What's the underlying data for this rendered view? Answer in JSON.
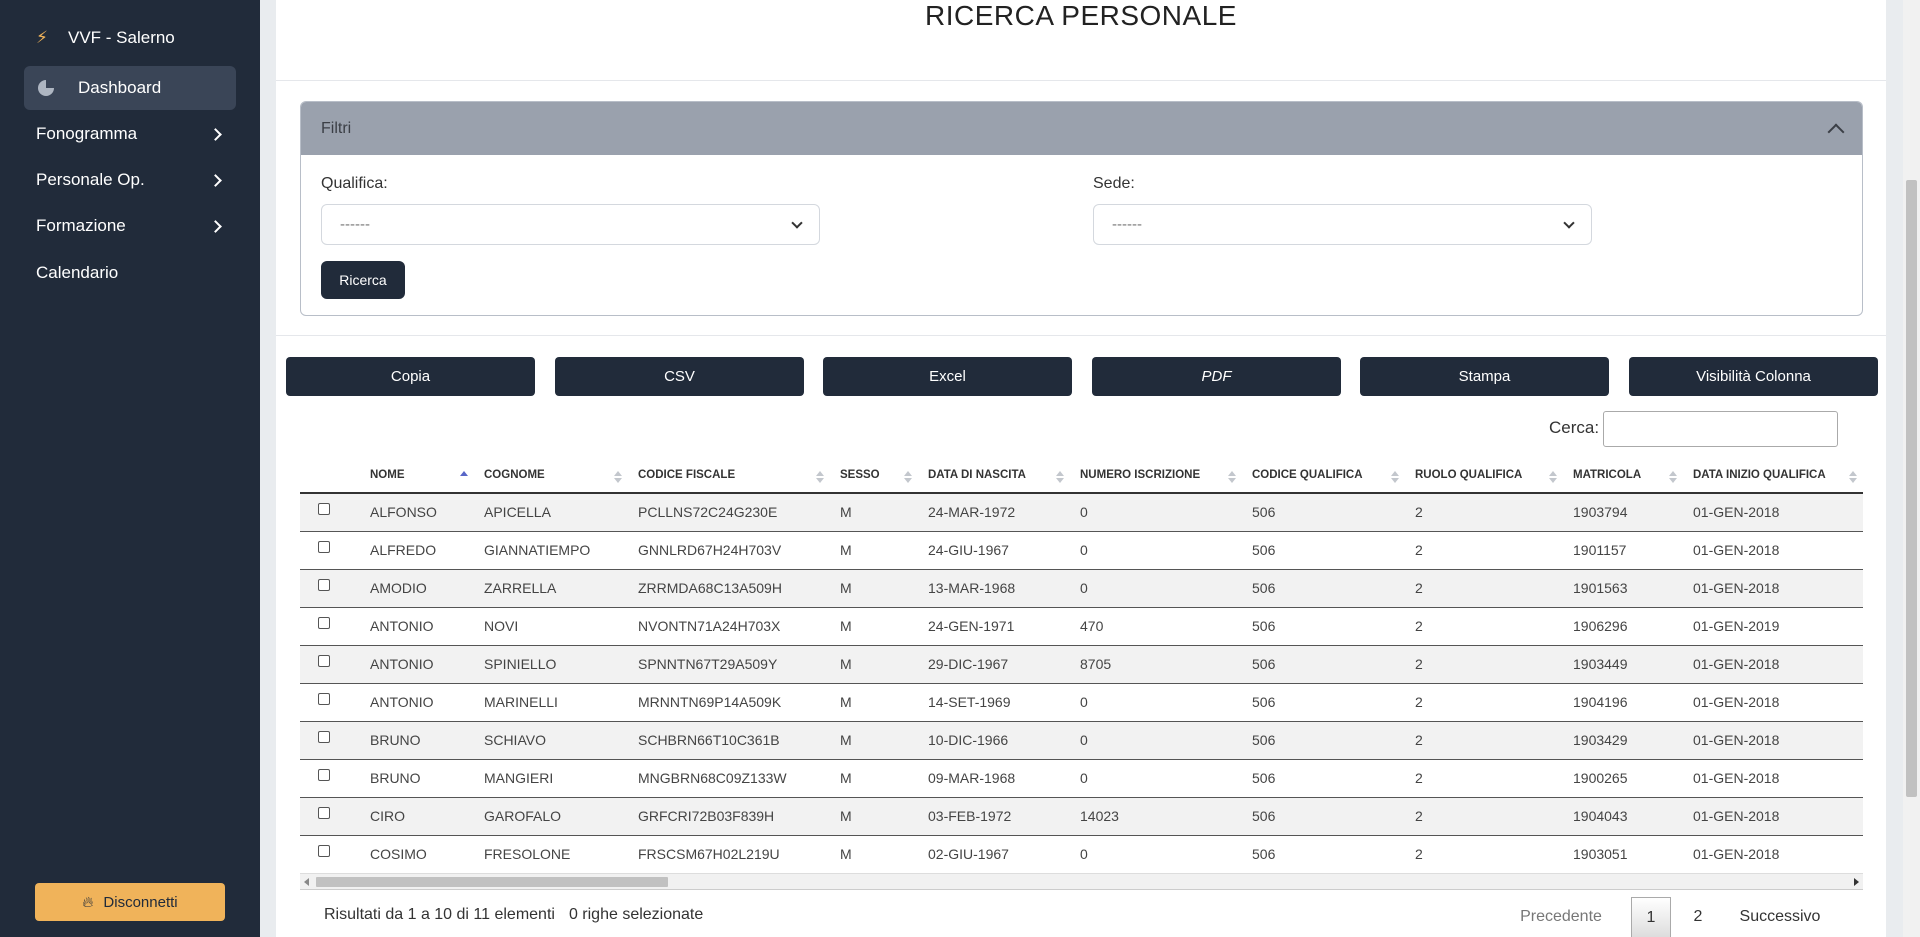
{
  "sidebar": {
    "brand": "VVF - Salerno",
    "dashboard": "Dashboard",
    "items": [
      "Fonogramma",
      "Personale Op.",
      "Formazione"
    ],
    "calendar": "Calendario",
    "logout": "Disconnetti"
  },
  "page": {
    "title": "RICERCA PERSONALE"
  },
  "filters": {
    "header": "Filtri",
    "qualifica_label": "Qualifica:",
    "qualifica_value": "------",
    "sede_label": "Sede:",
    "sede_value": "------",
    "search_button": "Ricerca"
  },
  "toolbar": [
    "Copia",
    "CSV",
    "Excel",
    "PDF",
    "Stampa",
    "Visibilità Colonna"
  ],
  "search": {
    "label": "Cerca:",
    "value": ""
  },
  "table": {
    "columns": [
      "NOME",
      "COGNOME",
      "CODICE FISCALE",
      "SESSO",
      "DATA DI NASCITA",
      "NUMERO ISCRIZIONE",
      "CODICE QUALIFICA",
      "RUOLO QUALIFICA",
      "MATRICOLA",
      "DATA INIZIO QUALIFICA"
    ],
    "sorted_column": "NOME",
    "rows": [
      [
        "ALFONSO",
        "APICELLA",
        "PCLLNS72C24G230E",
        "M",
        "24-MAR-1972",
        "0",
        "506",
        "2",
        "1903794",
        "01-GEN-2018"
      ],
      [
        "ALFREDO",
        "GIANNATIEMPO",
        "GNNLRD67H24H703V",
        "M",
        "24-GIU-1967",
        "0",
        "506",
        "2",
        "1901157",
        "01-GEN-2018"
      ],
      [
        "AMODIO",
        "ZARRELLA",
        "ZRRMDA68C13A509H",
        "M",
        "13-MAR-1968",
        "0",
        "506",
        "2",
        "1901563",
        "01-GEN-2018"
      ],
      [
        "ANTONIO",
        "NOVI",
        "NVONTN71A24H703X",
        "M",
        "24-GEN-1971",
        "470",
        "506",
        "2",
        "1906296",
        "01-GEN-2019"
      ],
      [
        "ANTONIO",
        "SPINIELLO",
        "SPNNTN67T29A509Y",
        "M",
        "29-DIC-1967",
        "8705",
        "506",
        "2",
        "1903449",
        "01-GEN-2018"
      ],
      [
        "ANTONIO",
        "MARINELLI",
        "MRNNTN69P14A509K",
        "M",
        "14-SET-1969",
        "0",
        "506",
        "2",
        "1904196",
        "01-GEN-2018"
      ],
      [
        "BRUNO",
        "SCHIAVO",
        "SCHBRN66T10C361B",
        "M",
        "10-DIC-1966",
        "0",
        "506",
        "2",
        "1903429",
        "01-GEN-2018"
      ],
      [
        "BRUNO",
        "MANGIERI",
        "MNGBRN68C09Z133W",
        "M",
        "09-MAR-1968",
        "0",
        "506",
        "2",
        "1900265",
        "01-GEN-2018"
      ],
      [
        "CIRO",
        "GAROFALO",
        "GRFCRI72B03F839H",
        "M",
        "03-FEB-1972",
        "14023",
        "506",
        "2",
        "1904043",
        "01-GEN-2018"
      ],
      [
        "COSIMO",
        "FRESOLONE",
        "FRSCSM67H02L219U",
        "M",
        "02-GIU-1967",
        "0",
        "506",
        "2",
        "1903051",
        "01-GEN-2018"
      ]
    ]
  },
  "footer": {
    "info": "Risultati da 1 a 10 di 11 elementi",
    "selected": "0 righe selezionate",
    "prev": "Precedente",
    "pages": [
      "1",
      "2"
    ],
    "next": "Successivo"
  }
}
